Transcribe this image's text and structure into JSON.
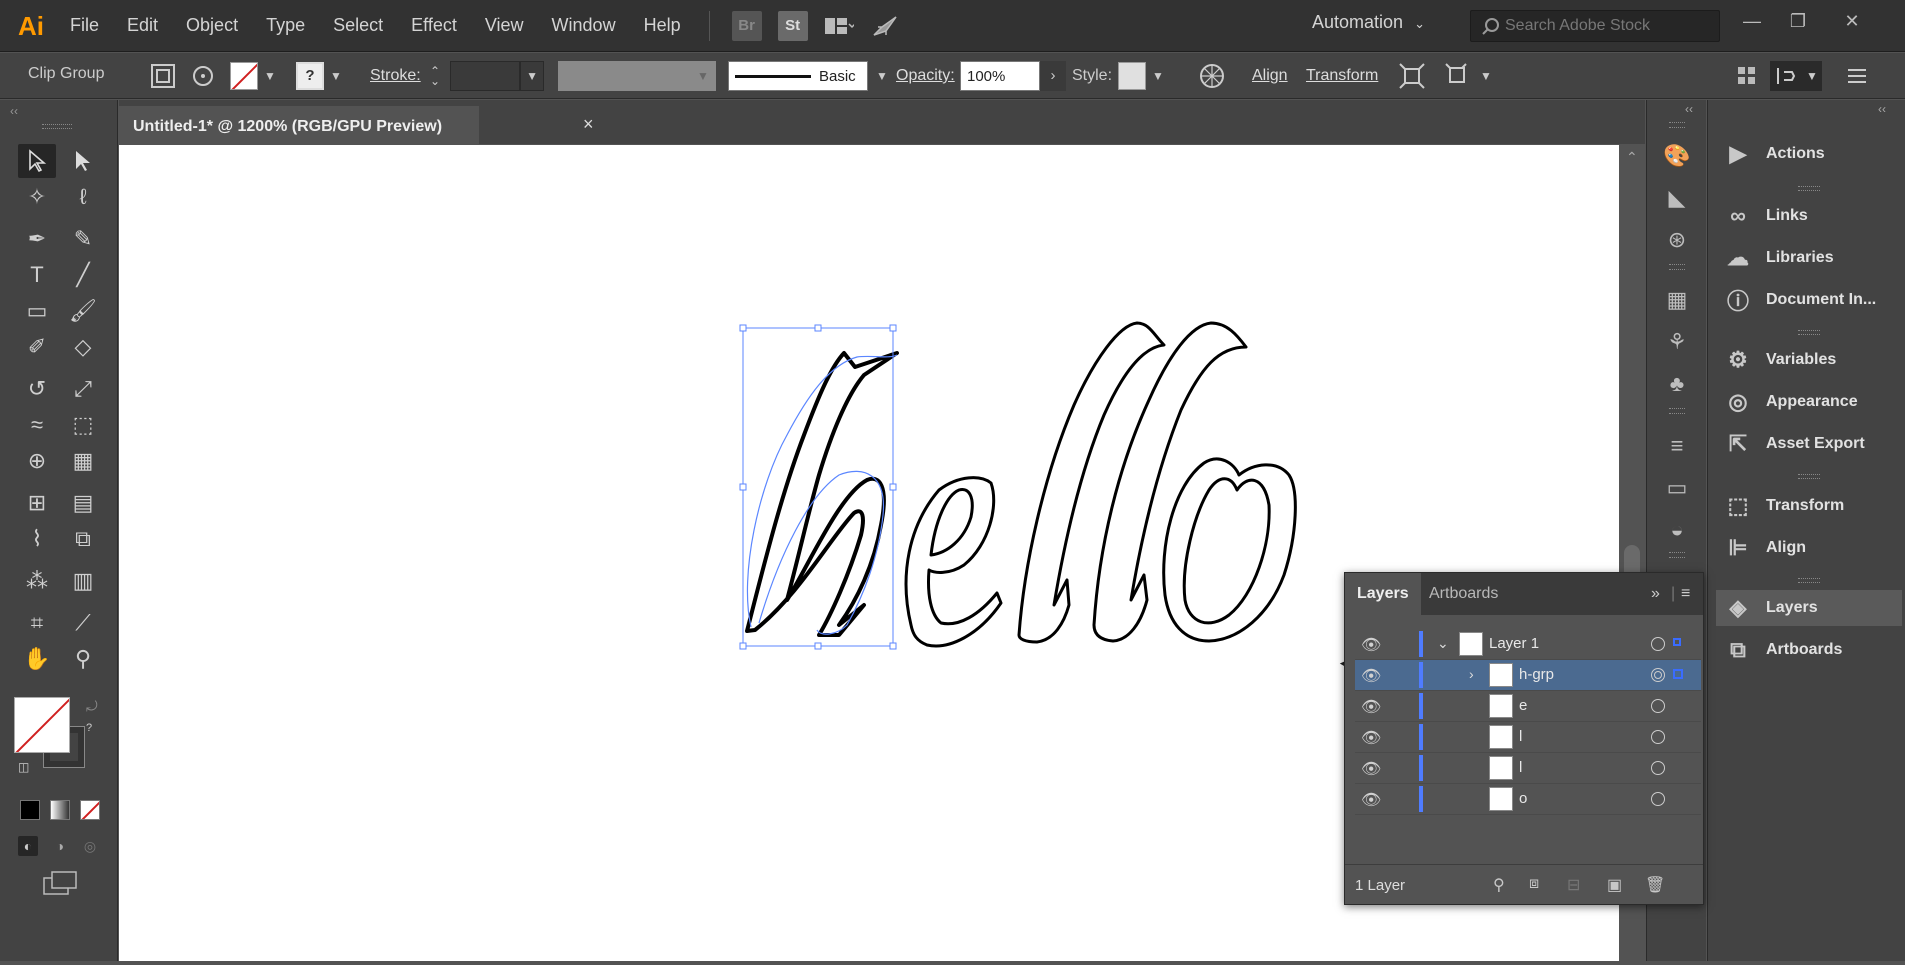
{
  "app": {
    "logo": "Ai",
    "menu": [
      "File",
      "Edit",
      "Object",
      "Type",
      "Select",
      "Effect",
      "View",
      "Window",
      "Help"
    ],
    "bridge_label": "Br",
    "stock_label": "St",
    "workspace": "Automation",
    "search_placeholder": "Search Adobe Stock"
  },
  "control_bar": {
    "selection_label": "Clip Group",
    "stroke_label": "Stroke:",
    "brush_label": "Basic",
    "opacity_label": "Opacity:",
    "opacity_value": "100%",
    "style_label": "Style:",
    "align_label": "Align",
    "transform_label": "Transform",
    "fill_question": "?"
  },
  "document": {
    "tab_title": "Untitled-1* @ 1200% (RGB/GPU Preview)",
    "close_glyph": "×",
    "artwork_text": "hello"
  },
  "right_panel": {
    "items": [
      {
        "label": "Actions",
        "icon": "play-icon"
      },
      {
        "label": "Links",
        "icon": "link-icon"
      },
      {
        "label": "Libraries",
        "icon": "libraries-icon"
      },
      {
        "label": "Document In...",
        "icon": "info-icon"
      },
      {
        "label": "Variables",
        "icon": "variables-icon"
      },
      {
        "label": "Appearance",
        "icon": "appearance-icon"
      },
      {
        "label": "Asset Export",
        "icon": "export-icon"
      },
      {
        "label": "Transform",
        "icon": "transform-icon"
      },
      {
        "label": "Align",
        "icon": "align-icon"
      },
      {
        "label": "Layers",
        "icon": "layers-icon"
      },
      {
        "label": "Artboards",
        "icon": "artboards-icon"
      }
    ]
  },
  "layers_panel": {
    "tabs": [
      "Layers",
      "Artboards"
    ],
    "layers": [
      {
        "name": "Layer 1",
        "expanded": true,
        "selected": false
      },
      {
        "name": "h-grp",
        "expanded": false,
        "selected": true
      },
      {
        "name": "e",
        "selected": false
      },
      {
        "name": "l",
        "selected": false
      },
      {
        "name": "l",
        "selected": false
      },
      {
        "name": "o",
        "selected": false
      }
    ],
    "footer_count": "1 Layer"
  },
  "colors": {
    "accent_blue": "#4f7cff",
    "selection_row": "#4b6a90",
    "logo_orange": "#ff9a00"
  }
}
